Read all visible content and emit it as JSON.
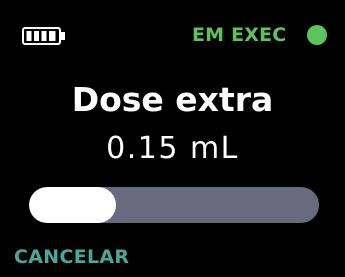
{
  "status_bar": {
    "battery_icon": "battery-full-icon",
    "battery_level": 1.0,
    "status_label": "EM EXEC",
    "status_icon": "running-dot-icon"
  },
  "dose": {
    "title": "Dose extra",
    "amount": "0.15 mL"
  },
  "progress": {
    "fraction": 0.3
  },
  "actions": {
    "cancel_label": "CANCELAR"
  },
  "colors": {
    "background": "#000000",
    "text": "#ffffff",
    "accent_green": "#5cc45a",
    "cancel_teal": "#4aa89a",
    "progress_track": "#6a6a7e",
    "progress_fill": "#ffffff"
  }
}
